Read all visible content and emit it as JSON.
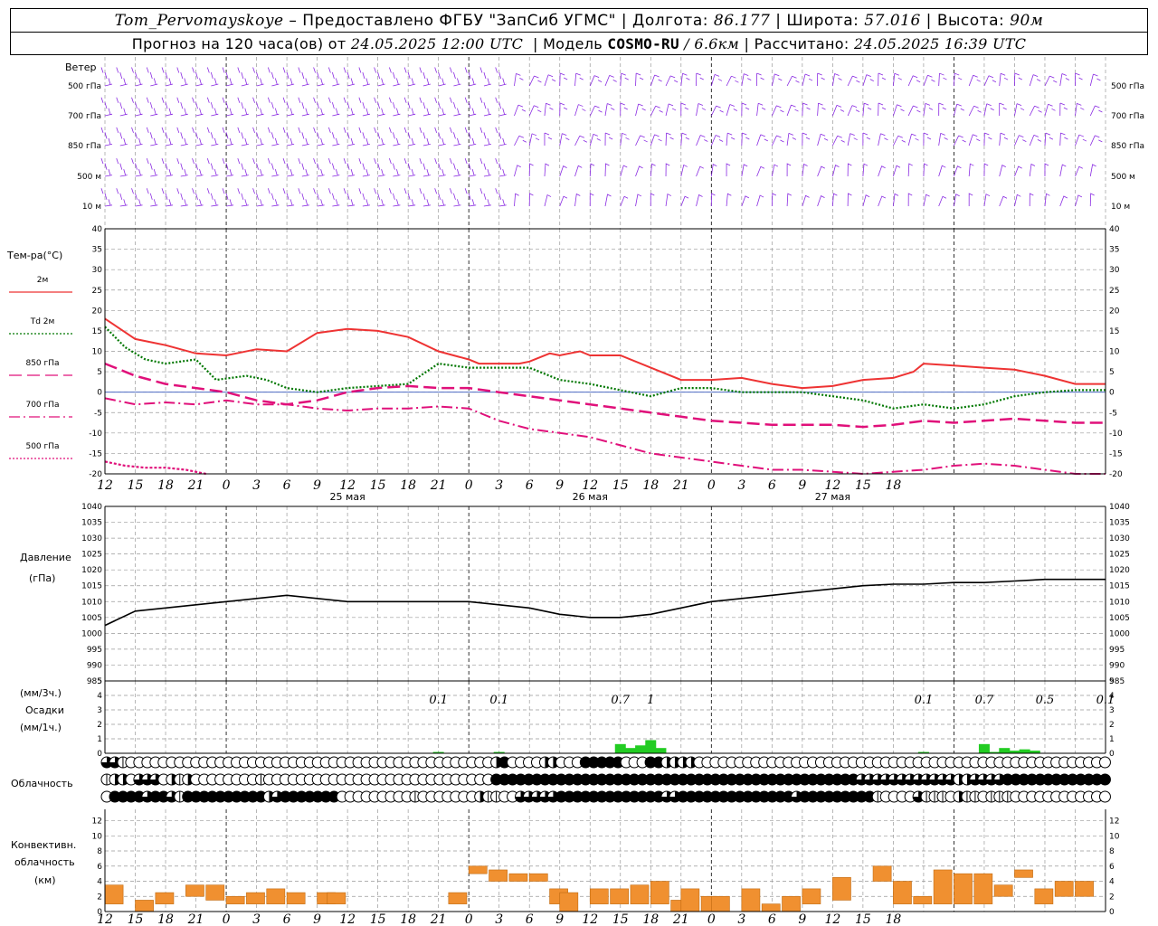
{
  "header": {
    "station": "Tom_Pervomayskoye",
    "provider": "– Предоставлено ФГБУ \"ЗапСиб УГМС\"",
    "lon_label": "Долгота:",
    "lon_value": "86.177",
    "lat_label": "Широта:",
    "lat_value": "57.016",
    "height_label": "Высота:",
    "height_value": "90м",
    "forecast_prefix": "Прогноз на 120 часа(ов) от",
    "forecast_date": "24.05.2025 12:00 UTC",
    "model_label": "Модель",
    "model_name": "COSMO-RU",
    "model_res": "/ 6.6км",
    "calc_label": "Рассчитано:",
    "calc_date": "24.05.2025 16:39 UTC"
  },
  "wind_panel": {
    "title": "Ветер",
    "levels": [
      "500 гПа",
      "700 гПа",
      "850 гПа",
      "500 м",
      "10  м"
    ],
    "right_levels": [
      "500 гПа",
      "700 гПа",
      "850 гПа",
      "500 м",
      "10  м"
    ],
    "barb_color": "#8a2be2"
  },
  "temp_panel": {
    "title": "Тем-ра(°С)",
    "legend": [
      {
        "label": "2м",
        "color": "#ee3333",
        "style": "solid"
      },
      {
        "label": "Td  2м",
        "color": "#007700",
        "style": "dot"
      },
      {
        "label": "850 гПа",
        "color": "#e0107a",
        "style": "longdash"
      },
      {
        "label": "700 гПа",
        "color": "#e0107a",
        "style": "dashdot"
      },
      {
        "label": "500 гПа",
        "color": "#e0107a",
        "style": "dot"
      }
    ],
    "yticks": [
      "40",
      "35",
      "30",
      "25",
      "20",
      "15",
      "10",
      "5",
      "0",
      "-5",
      "-10",
      "-15",
      "-20"
    ]
  },
  "pressure_panel": {
    "title": "Давление",
    "unit": "(гПа)",
    "yticks": [
      "1040",
      "1035",
      "1030",
      "1025",
      "1020",
      "1015",
      "1010",
      "1005",
      "1000",
      "995",
      "990",
      "985"
    ]
  },
  "precip_panel": {
    "unit3": "(мм/3ч.)",
    "title": "Осадки",
    "unit1": "(мм/1ч.)",
    "yticks": [
      "5",
      "4",
      "3",
      "2",
      "1",
      "0"
    ],
    "labels": [
      {
        "hour": 33,
        "text": "0.1"
      },
      {
        "hour": 39,
        "text": "0.1"
      },
      {
        "hour": 51,
        "text": "0.7"
      },
      {
        "hour": 54,
        "text": "1"
      },
      {
        "hour": 81,
        "text": "0.1"
      },
      {
        "hour": 87,
        "text": "0.7"
      },
      {
        "hour": 93,
        "text": "0.5"
      },
      {
        "hour": 99,
        "text": "0.1"
      }
    ],
    "color": "#22cc22"
  },
  "cloud_panel": {
    "title": "Облачность",
    "rows": [
      "3310000000000000000000000000000000000000000000002400002200044444000442222000000000000000000000000000000000000000000000000000",
      "1220333021200000000100000000000000000000000000004444444444444444444444444444444444444444444443333333333332233334444444444444",
      "0444434431444444444423444444400000000010000000211003333344444444444443344444444444444344444444410000311102110111000000000000"
    ]
  },
  "conv_panel": {
    "title1": "Конвективн.",
    "title2": "облачность",
    "unit": "(км)",
    "yticks": [
      "12",
      "10",
      "8",
      "6",
      "4",
      "2",
      "0"
    ],
    "color": "#f09030"
  },
  "x_axis": {
    "hour_labels": [
      "12",
      "15",
      "18",
      "21",
      "0",
      "3",
      "6",
      "9",
      "12",
      "15",
      "18",
      "21",
      "0",
      "3",
      "6",
      "9",
      "12",
      "15",
      "18",
      "21",
      "0",
      "3",
      "6",
      "9",
      "12",
      "15",
      "18"
    ],
    "dates": [
      "25 мая",
      "26 мая",
      "27 мая"
    ]
  },
  "chart_data": {
    "type": "line",
    "title": "Прогноз на 120 часа(ов) от 24.05.2025 12:00 UTC",
    "x_unit": "hours since 24.05.2025 12:00 UTC",
    "series": [
      {
        "name": "2м",
        "points": [
          [
            0,
            18
          ],
          [
            3,
            13
          ],
          [
            6,
            11.5
          ],
          [
            9,
            9.5
          ],
          [
            12,
            9
          ],
          [
            15,
            10.5
          ],
          [
            18,
            10
          ],
          [
            21,
            14.5
          ],
          [
            24,
            15.5
          ],
          [
            27,
            15
          ],
          [
            30,
            13.5
          ],
          [
            33,
            10
          ],
          [
            36,
            8
          ],
          [
            37,
            7
          ],
          [
            41,
            7
          ],
          [
            42,
            7.5
          ],
          [
            44,
            9.5
          ],
          [
            45,
            9
          ],
          [
            47,
            10
          ],
          [
            48,
            9
          ],
          [
            51,
            9
          ],
          [
            54,
            6
          ],
          [
            57,
            3
          ],
          [
            60,
            3
          ],
          [
            63,
            3.5
          ],
          [
            66,
            2
          ],
          [
            69,
            1
          ],
          [
            72,
            1.5
          ],
          [
            75,
            3
          ],
          [
            78,
            3.5
          ],
          [
            80,
            5
          ],
          [
            81,
            7
          ],
          [
            84,
            6.5
          ],
          [
            87,
            6
          ],
          [
            90,
            5.5
          ],
          [
            93,
            4
          ],
          [
            96,
            2
          ],
          [
            99,
            2
          ]
        ]
      },
      {
        "name": "Td  2м",
        "points": [
          [
            0,
            16
          ],
          [
            2,
            11
          ],
          [
            4,
            8
          ],
          [
            6,
            7
          ],
          [
            9,
            8
          ],
          [
            11,
            3
          ],
          [
            14,
            4
          ],
          [
            16,
            3
          ],
          [
            18,
            1
          ],
          [
            21,
            0
          ],
          [
            24,
            1
          ],
          [
            27,
            1.5
          ],
          [
            30,
            2
          ],
          [
            33,
            7
          ],
          [
            36,
            6
          ],
          [
            42,
            6
          ],
          [
            45,
            3
          ],
          [
            48,
            2
          ],
          [
            51,
            0.5
          ],
          [
            54,
            -1
          ],
          [
            57,
            1
          ],
          [
            60,
            1
          ],
          [
            63,
            0
          ],
          [
            66,
            0
          ],
          [
            69,
            0
          ],
          [
            72,
            -1
          ],
          [
            75,
            -2
          ],
          [
            78,
            -4
          ],
          [
            81,
            -3
          ],
          [
            84,
            -4
          ],
          [
            87,
            -3
          ],
          [
            90,
            -1
          ],
          [
            93,
            0
          ],
          [
            96,
            0.5
          ],
          [
            99,
            0.5
          ]
        ]
      },
      {
        "name": "850 гПа",
        "points": [
          [
            0,
            7
          ],
          [
            3,
            4
          ],
          [
            6,
            2
          ],
          [
            9,
            1
          ],
          [
            12,
            0
          ],
          [
            15,
            -2
          ],
          [
            18,
            -3
          ],
          [
            21,
            -2
          ],
          [
            24,
            0
          ],
          [
            27,
            1
          ],
          [
            30,
            1.5
          ],
          [
            33,
            1
          ],
          [
            36,
            1
          ],
          [
            39,
            0
          ],
          [
            42,
            -1
          ],
          [
            45,
            -2
          ],
          [
            48,
            -3
          ],
          [
            51,
            -4
          ],
          [
            54,
            -5
          ],
          [
            57,
            -6
          ],
          [
            60,
            -7
          ],
          [
            63,
            -7.5
          ],
          [
            66,
            -8
          ],
          [
            69,
            -8
          ],
          [
            72,
            -8
          ],
          [
            75,
            -8.5
          ],
          [
            78,
            -8
          ],
          [
            81,
            -7
          ],
          [
            84,
            -7.5
          ],
          [
            87,
            -7
          ],
          [
            90,
            -6.5
          ],
          [
            93,
            -7
          ],
          [
            96,
            -7.5
          ],
          [
            99,
            -7.5
          ]
        ]
      },
      {
        "name": "700 гПа",
        "points": [
          [
            0,
            -1.5
          ],
          [
            3,
            -3
          ],
          [
            6,
            -2.5
          ],
          [
            9,
            -3
          ],
          [
            12,
            -2
          ],
          [
            15,
            -3
          ],
          [
            18,
            -3
          ],
          [
            21,
            -4
          ],
          [
            24,
            -4.5
          ],
          [
            27,
            -4
          ],
          [
            30,
            -4
          ],
          [
            33,
            -3.5
          ],
          [
            36,
            -4
          ],
          [
            39,
            -7
          ],
          [
            42,
            -9
          ],
          [
            45,
            -10
          ],
          [
            48,
            -11
          ],
          [
            51,
            -13
          ],
          [
            54,
            -15
          ],
          [
            57,
            -16
          ],
          [
            60,
            -17
          ],
          [
            63,
            -18
          ],
          [
            66,
            -19
          ],
          [
            69,
            -19
          ],
          [
            72,
            -19.5
          ],
          [
            75,
            -20
          ],
          [
            78,
            -19.5
          ],
          [
            81,
            -19
          ],
          [
            84,
            -18
          ],
          [
            87,
            -17.5
          ],
          [
            90,
            -18
          ],
          [
            93,
            -19
          ],
          [
            96,
            -20
          ],
          [
            99,
            -20
          ]
        ]
      },
      {
        "name": "500 гПа",
        "points": [
          [
            0,
            -17
          ],
          [
            2,
            -18
          ],
          [
            4,
            -18.5
          ],
          [
            6,
            -18.5
          ],
          [
            8,
            -19
          ],
          [
            10,
            -20
          ]
        ]
      },
      {
        "name": "Давление",
        "points": [
          [
            0,
            1002.5
          ],
          [
            3,
            1007
          ],
          [
            6,
            1008
          ],
          [
            9,
            1009
          ],
          [
            12,
            1010
          ],
          [
            15,
            1011
          ],
          [
            18,
            1012
          ],
          [
            21,
            1011
          ],
          [
            24,
            1010
          ],
          [
            27,
            1010
          ],
          [
            30,
            1010
          ],
          [
            33,
            1010
          ],
          [
            36,
            1010
          ],
          [
            39,
            1009
          ],
          [
            42,
            1008
          ],
          [
            45,
            1006
          ],
          [
            48,
            1005
          ],
          [
            51,
            1005
          ],
          [
            54,
            1006
          ],
          [
            57,
            1008
          ],
          [
            60,
            1010
          ],
          [
            63,
            1011
          ],
          [
            66,
            1012
          ],
          [
            69,
            1013
          ],
          [
            72,
            1014
          ],
          [
            75,
            1015
          ],
          [
            78,
            1015.5
          ],
          [
            81,
            1015.5
          ],
          [
            84,
            1016
          ],
          [
            87,
            1016
          ],
          [
            90,
            1016.5
          ],
          [
            93,
            1017
          ],
          [
            96,
            1017
          ],
          [
            99,
            1017
          ]
        ]
      },
      {
        "name": "Осадки",
        "points": [
          [
            33,
            0.1
          ],
          [
            39,
            0.1
          ],
          [
            51,
            0.7
          ],
          [
            52,
            0.4
          ],
          [
            53,
            0.6
          ],
          [
            54,
            1
          ],
          [
            55,
            0.4
          ],
          [
            81,
            0.1
          ],
          [
            87,
            0.7
          ],
          [
            88,
            0.1
          ],
          [
            89,
            0.4
          ],
          [
            90,
            0.2
          ],
          [
            91,
            0.3
          ],
          [
            92,
            0.2
          ]
        ]
      },
      {
        "name": "Конвективн. облачность",
        "bars": [
          [
            0,
            1,
            2.5
          ],
          [
            3,
            0,
            1.5
          ],
          [
            5,
            1,
            1.5
          ],
          [
            8,
            2,
            1.5
          ],
          [
            10,
            1.5,
            2
          ],
          [
            12,
            1,
            1
          ],
          [
            14,
            1,
            1.5
          ],
          [
            16,
            1,
            2
          ],
          [
            18,
            1,
            1.5
          ],
          [
            21,
            1,
            1.5
          ],
          [
            22,
            1,
            1.5
          ],
          [
            34,
            1,
            1.5
          ],
          [
            36,
            5,
            1
          ],
          [
            38,
            4,
            1.5
          ],
          [
            40,
            4,
            1
          ],
          [
            42,
            4,
            1
          ],
          [
            44,
            1,
            2
          ],
          [
            45,
            0,
            2.5
          ],
          [
            48,
            1,
            2
          ],
          [
            50,
            1,
            2
          ],
          [
            52,
            1,
            2.5
          ],
          [
            54,
            1,
            3
          ],
          [
            56,
            0,
            1.5
          ],
          [
            57,
            0,
            3
          ],
          [
            59,
            0,
            2
          ],
          [
            60,
            0,
            2
          ],
          [
            63,
            0,
            3
          ],
          [
            65,
            0,
            1
          ],
          [
            67,
            0,
            2
          ],
          [
            69,
            1,
            2
          ],
          [
            72,
            1.5,
            3
          ],
          [
            76,
            4,
            2
          ],
          [
            78,
            1,
            3
          ],
          [
            80,
            1,
            1
          ],
          [
            82,
            1,
            4.5
          ],
          [
            84,
            1,
            4
          ],
          [
            86,
            1,
            4
          ],
          [
            88,
            2,
            1.5
          ],
          [
            90,
            4.5,
            1
          ],
          [
            92,
            1,
            2
          ],
          [
            94,
            2,
            2
          ],
          [
            96,
            2,
            2
          ]
        ]
      }
    ],
    "y_ranges": {
      "temperature": [
        -20,
        40
      ],
      "pressure": [
        985,
        1040
      ],
      "precip": [
        0,
        5
      ],
      "convective_km": [
        0,
        13
      ]
    },
    "grid": true
  }
}
